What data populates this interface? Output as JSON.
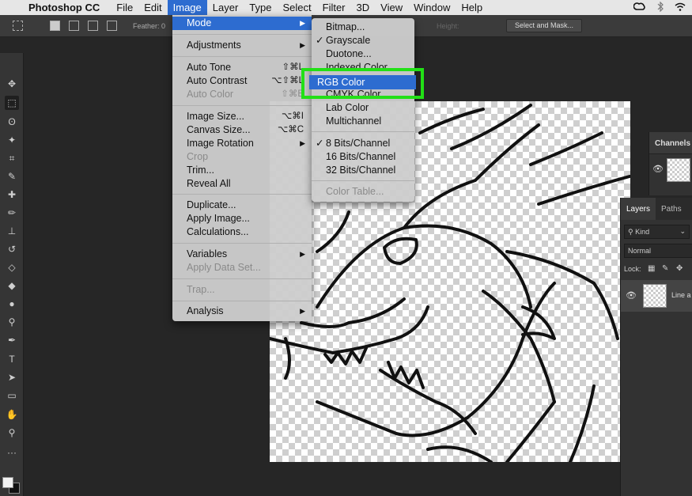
{
  "menubar": {
    "app_name": "Photoshop CC",
    "items": [
      "File",
      "Edit",
      "Image",
      "Layer",
      "Type",
      "Select",
      "Filter",
      "3D",
      "View",
      "Window",
      "Help"
    ],
    "active": "Image",
    "status_icons": [
      "creative-cloud-icon",
      "bluetooth-icon",
      "wifi-icon"
    ]
  },
  "options_bar": {
    "feather_label": "Feather: 0",
    "height_label": "Height:",
    "select_and_mask": "Select and Mask..."
  },
  "image_menu": {
    "mode": "Mode",
    "adjustments": "Adjustments",
    "auto_tone": "Auto Tone",
    "auto_tone_sc": "⇧⌘L",
    "auto_contrast": "Auto Contrast",
    "auto_contrast_sc": "⌥⇧⌘L",
    "auto_color": "Auto Color",
    "auto_color_sc": "⇧⌘B",
    "image_size": "Image Size...",
    "image_size_sc": "⌥⌘I",
    "canvas_size": "Canvas Size...",
    "canvas_size_sc": "⌥⌘C",
    "image_rotation": "Image Rotation",
    "crop": "Crop",
    "trim": "Trim...",
    "reveal_all": "Reveal All",
    "duplicate": "Duplicate...",
    "apply_image": "Apply Image...",
    "calculations": "Calculations...",
    "variables": "Variables",
    "apply_data_set": "Apply Data Set...",
    "trap": "Trap...",
    "analysis": "Analysis"
  },
  "mode_submenu": {
    "bitmap": "Bitmap...",
    "grayscale": "Grayscale",
    "duotone": "Duotone...",
    "indexed": "Indexed Color...",
    "rgb": "RGB Color",
    "cmyk": "CMYK Color",
    "lab": "Lab Color",
    "multichannel": "Multichannel",
    "bits8": "8 Bits/Channel",
    "bits16": "16 Bits/Channel",
    "bits32": "32 Bits/Channel",
    "color_table": "Color Table...",
    "checked": [
      "Grayscale",
      "8 Bits/Channel"
    ]
  },
  "channels_panel": {
    "title": "Channels"
  },
  "layers_panel": {
    "tabs": [
      "Layers",
      "Paths"
    ],
    "kind_filter": "Kind",
    "blend_mode": "Normal",
    "lock_label": "Lock:",
    "layer_name": "Line a"
  },
  "colors": {
    "highlight": "#2d6cd0",
    "annotation": "#22e016",
    "ui_dark": "#262626"
  }
}
